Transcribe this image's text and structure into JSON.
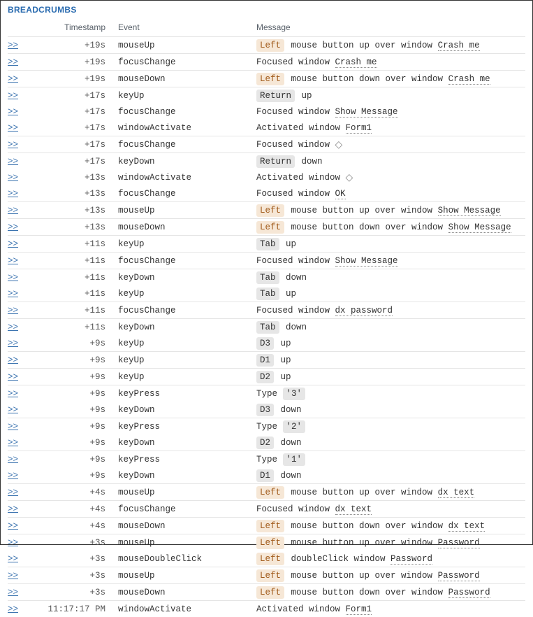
{
  "title": "BREADCRUMBS",
  "link_label": ">>",
  "columns": {
    "timestamp": "Timestamp",
    "event": "Event",
    "message": "Message"
  },
  "rows": [
    {
      "ts": "+19s",
      "event": "mouseUp",
      "msg": [
        {
          "t": "badge",
          "style": "orange",
          "v": "Left"
        },
        {
          "t": "text",
          "v": " mouse button up over window "
        },
        {
          "t": "win",
          "v": "Crash me"
        }
      ],
      "border": true
    },
    {
      "ts": "+19s",
      "event": "focusChange",
      "msg": [
        {
          "t": "text",
          "v": "Focused window "
        },
        {
          "t": "win",
          "v": "Crash me"
        }
      ],
      "border": true
    },
    {
      "ts": "+19s",
      "event": "mouseDown",
      "msg": [
        {
          "t": "badge",
          "style": "orange",
          "v": "Left"
        },
        {
          "t": "text",
          "v": " mouse button down over window "
        },
        {
          "t": "win",
          "v": "Crash me"
        }
      ],
      "border": true
    },
    {
      "ts": "+17s",
      "event": "keyUp",
      "msg": [
        {
          "t": "badge",
          "style": "gray",
          "v": "Return"
        },
        {
          "t": "text",
          "v": " up"
        }
      ],
      "border": true
    },
    {
      "ts": "+17s",
      "event": "focusChange",
      "msg": [
        {
          "t": "text",
          "v": "Focused window "
        },
        {
          "t": "win",
          "v": "Show Message"
        }
      ],
      "border": false
    },
    {
      "ts": "+17s",
      "event": "windowActivate",
      "msg": [
        {
          "t": "text",
          "v": "Activated window "
        },
        {
          "t": "win",
          "v": "Form1"
        }
      ],
      "border": false
    },
    {
      "ts": "+17s",
      "event": "focusChange",
      "msg": [
        {
          "t": "text",
          "v": "Focused window "
        },
        {
          "t": "diamond"
        }
      ],
      "border": true
    },
    {
      "ts": "+17s",
      "event": "keyDown",
      "msg": [
        {
          "t": "badge",
          "style": "gray",
          "v": "Return"
        },
        {
          "t": "text",
          "v": " down"
        }
      ],
      "border": true
    },
    {
      "ts": "+13s",
      "event": "windowActivate",
      "msg": [
        {
          "t": "text",
          "v": "Activated window "
        },
        {
          "t": "diamond"
        }
      ],
      "border": false
    },
    {
      "ts": "+13s",
      "event": "focusChange",
      "msg": [
        {
          "t": "text",
          "v": "Focused window "
        },
        {
          "t": "win",
          "v": "OK"
        }
      ],
      "border": false
    },
    {
      "ts": "+13s",
      "event": "mouseUp",
      "msg": [
        {
          "t": "badge",
          "style": "orange",
          "v": "Left"
        },
        {
          "t": "text",
          "v": " mouse button up over window "
        },
        {
          "t": "win",
          "v": "Show Message"
        }
      ],
      "border": true
    },
    {
      "ts": "+13s",
      "event": "mouseDown",
      "msg": [
        {
          "t": "badge",
          "style": "orange",
          "v": "Left"
        },
        {
          "t": "text",
          "v": " mouse button down over window "
        },
        {
          "t": "win",
          "v": "Show Message"
        }
      ],
      "border": true
    },
    {
      "ts": "+11s",
      "event": "keyUp",
      "msg": [
        {
          "t": "badge",
          "style": "gray",
          "v": "Tab"
        },
        {
          "t": "text",
          "v": " up"
        }
      ],
      "border": true
    },
    {
      "ts": "+11s",
      "event": "focusChange",
      "msg": [
        {
          "t": "text",
          "v": "Focused window "
        },
        {
          "t": "win",
          "v": "Show Message"
        }
      ],
      "border": true
    },
    {
      "ts": "+11s",
      "event": "keyDown",
      "msg": [
        {
          "t": "badge",
          "style": "gray",
          "v": "Tab"
        },
        {
          "t": "text",
          "v": " down"
        }
      ],
      "border": true
    },
    {
      "ts": "+11s",
      "event": "keyUp",
      "msg": [
        {
          "t": "badge",
          "style": "gray",
          "v": "Tab"
        },
        {
          "t": "text",
          "v": " up"
        }
      ],
      "border": false
    },
    {
      "ts": "+11s",
      "event": "focusChange",
      "msg": [
        {
          "t": "text",
          "v": "Focused window "
        },
        {
          "t": "win",
          "v": "dx password"
        }
      ],
      "border": true
    },
    {
      "ts": "+11s",
      "event": "keyDown",
      "msg": [
        {
          "t": "badge",
          "style": "gray",
          "v": "Tab"
        },
        {
          "t": "text",
          "v": " down"
        }
      ],
      "border": true
    },
    {
      "ts": "+9s",
      "event": "keyUp",
      "msg": [
        {
          "t": "badge",
          "style": "gray",
          "v": "D3"
        },
        {
          "t": "text",
          "v": " up"
        }
      ],
      "border": false
    },
    {
      "ts": "+9s",
      "event": "keyUp",
      "msg": [
        {
          "t": "badge",
          "style": "gray",
          "v": "D1"
        },
        {
          "t": "text",
          "v": " up"
        }
      ],
      "border": true
    },
    {
      "ts": "+9s",
      "event": "keyUp",
      "msg": [
        {
          "t": "badge",
          "style": "gray",
          "v": "D2"
        },
        {
          "t": "text",
          "v": " up"
        }
      ],
      "border": true
    },
    {
      "ts": "+9s",
      "event": "keyPress",
      "msg": [
        {
          "t": "text",
          "v": "Type "
        },
        {
          "t": "badge",
          "style": "gray",
          "v": "'3'"
        }
      ],
      "border": true
    },
    {
      "ts": "+9s",
      "event": "keyDown",
      "msg": [
        {
          "t": "badge",
          "style": "gray",
          "v": "D3"
        },
        {
          "t": "text",
          "v": " down"
        }
      ],
      "border": false
    },
    {
      "ts": "+9s",
      "event": "keyPress",
      "msg": [
        {
          "t": "text",
          "v": "Type "
        },
        {
          "t": "badge",
          "style": "gray",
          "v": "'2'"
        }
      ],
      "border": true
    },
    {
      "ts": "+9s",
      "event": "keyDown",
      "msg": [
        {
          "t": "badge",
          "style": "gray",
          "v": "D2"
        },
        {
          "t": "text",
          "v": " down"
        }
      ],
      "border": false
    },
    {
      "ts": "+9s",
      "event": "keyPress",
      "msg": [
        {
          "t": "text",
          "v": "Type "
        },
        {
          "t": "badge",
          "style": "gray",
          "v": "'1'"
        }
      ],
      "border": true
    },
    {
      "ts": "+9s",
      "event": "keyDown",
      "msg": [
        {
          "t": "badge",
          "style": "gray",
          "v": "D1"
        },
        {
          "t": "text",
          "v": " down"
        }
      ],
      "border": false
    },
    {
      "ts": "+4s",
      "event": "mouseUp",
      "msg": [
        {
          "t": "badge",
          "style": "orange",
          "v": "Left"
        },
        {
          "t": "text",
          "v": " mouse button up over window "
        },
        {
          "t": "win",
          "v": "dx text"
        }
      ],
      "border": true
    },
    {
      "ts": "+4s",
      "event": "focusChange",
      "msg": [
        {
          "t": "text",
          "v": "Focused window "
        },
        {
          "t": "win",
          "v": "dx text"
        }
      ],
      "border": true
    },
    {
      "ts": "+4s",
      "event": "mouseDown",
      "msg": [
        {
          "t": "badge",
          "style": "orange",
          "v": "Left"
        },
        {
          "t": "text",
          "v": " mouse button down over window "
        },
        {
          "t": "win",
          "v": "dx text"
        }
      ],
      "border": true
    },
    {
      "ts": "+3s",
      "event": "mouseUp",
      "msg": [
        {
          "t": "badge",
          "style": "orange",
          "v": "Left"
        },
        {
          "t": "text",
          "v": " mouse button up over window "
        },
        {
          "t": "win",
          "v": "Password"
        }
      ],
      "border": true
    },
    {
      "ts": "+3s",
      "event": "mouseDoubleClick",
      "msg": [
        {
          "t": "badge",
          "style": "orange",
          "v": "Left"
        },
        {
          "t": "text",
          "v": " doubleClick window "
        },
        {
          "t": "win",
          "v": "Password"
        }
      ],
      "border": false
    },
    {
      "ts": "+3s",
      "event": "mouseUp",
      "msg": [
        {
          "t": "badge",
          "style": "orange",
          "v": "Left"
        },
        {
          "t": "text",
          "v": " mouse button up over window "
        },
        {
          "t": "win",
          "v": "Password"
        }
      ],
      "border": true
    },
    {
      "ts": "+3s",
      "event": "mouseDown",
      "msg": [
        {
          "t": "badge",
          "style": "orange",
          "v": "Left"
        },
        {
          "t": "text",
          "v": " mouse button down over window "
        },
        {
          "t": "win",
          "v": "Password"
        }
      ],
      "border": true
    },
    {
      "ts": "11:17:17 PM",
      "event": "windowActivate",
      "msg": [
        {
          "t": "text",
          "v": "Activated window "
        },
        {
          "t": "win",
          "v": "Form1"
        }
      ],
      "border": true
    }
  ]
}
